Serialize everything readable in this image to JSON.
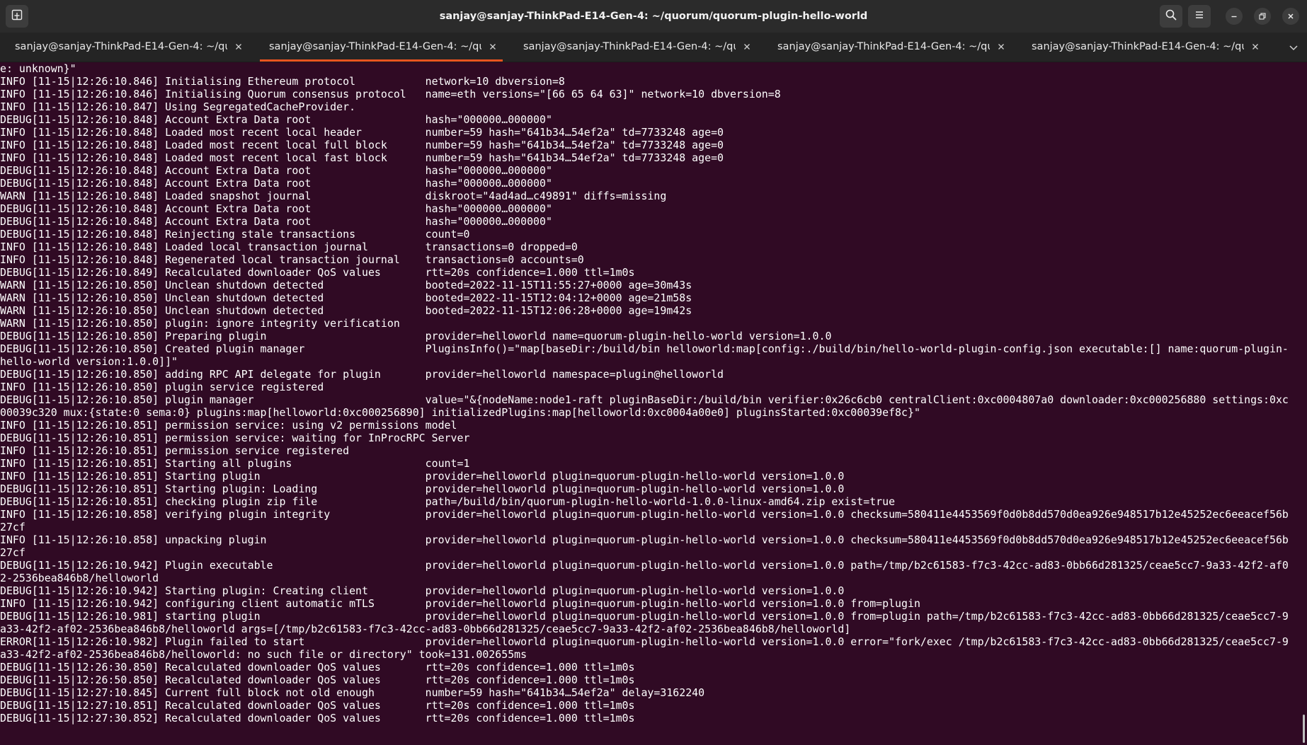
{
  "window": {
    "title": "sanjay@sanjay-ThinkPad-E14-Gen-4: ~/quorum/quorum-plugin-hello-world"
  },
  "header_buttons": {
    "new_tab_icon": "new-tab-icon",
    "search_icon": "search-icon",
    "menu_icon": "hamburger-menu-icon",
    "minimize_icon": "minimize-icon",
    "maximize_icon": "maximize-icon",
    "close_icon": "close-icon"
  },
  "tabs": [
    {
      "label": "sanjay@sanjay-ThinkPad-E14-Gen-4: ~/quo…",
      "active": false
    },
    {
      "label": "sanjay@sanjay-ThinkPad-E14-Gen-4: ~/quo…",
      "active": true
    },
    {
      "label": "sanjay@sanjay-ThinkPad-E14-Gen-4: ~/quo…",
      "active": false
    },
    {
      "label": "sanjay@sanjay-ThinkPad-E14-Gen-4: ~/quo…",
      "active": false
    },
    {
      "label": "sanjay@sanjay-ThinkPad-E14-Gen-4: ~/quo…",
      "active": false
    }
  ],
  "colors": {
    "terminal_bg": "#300a24",
    "header_bg": "#2b2b2b",
    "tab_bg": "#242424",
    "accent": "#e95420",
    "text": "#ffffff"
  },
  "terminal": {
    "lines": [
      "e: unknown}\"",
      "INFO [11-15|12:26:10.846] Initialising Ethereum protocol           network=10 dbversion=8",
      "INFO [11-15|12:26:10.846] Initialising Quorum consensus protocol   name=eth versions=\"[66 65 64 63]\" network=10 dbversion=8",
      "INFO [11-15|12:26:10.847] Using SegregatedCacheProvider.",
      "DEBUG[11-15|12:26:10.848] Account Extra Data root                  hash=\"000000…000000\"",
      "INFO [11-15|12:26:10.848] Loaded most recent local header          number=59 hash=\"641b34…54ef2a\" td=7733248 age=0",
      "INFO [11-15|12:26:10.848] Loaded most recent local full block      number=59 hash=\"641b34…54ef2a\" td=7733248 age=0",
      "INFO [11-15|12:26:10.848] Loaded most recent local fast block      number=59 hash=\"641b34…54ef2a\" td=7733248 age=0",
      "DEBUG[11-15|12:26:10.848] Account Extra Data root                  hash=\"000000…000000\"",
      "DEBUG[11-15|12:26:10.848] Account Extra Data root                  hash=\"000000…000000\"",
      "WARN [11-15|12:26:10.848] Loaded snapshot journal                  diskroot=\"4ad4ad…c49891\" diffs=missing",
      "DEBUG[11-15|12:26:10.848] Account Extra Data root                  hash=\"000000…000000\"",
      "DEBUG[11-15|12:26:10.848] Account Extra Data root                  hash=\"000000…000000\"",
      "DEBUG[11-15|12:26:10.848] Reinjecting stale transactions           count=0",
      "INFO [11-15|12:26:10.848] Loaded local transaction journal         transactions=0 dropped=0",
      "INFO [11-15|12:26:10.848] Regenerated local transaction journal    transactions=0 accounts=0",
      "DEBUG[11-15|12:26:10.849] Recalculated downloader QoS values       rtt=20s confidence=1.000 ttl=1m0s",
      "WARN [11-15|12:26:10.850] Unclean shutdown detected                booted=2022-11-15T11:55:27+0000 age=30m43s",
      "WARN [11-15|12:26:10.850] Unclean shutdown detected                booted=2022-11-15T12:04:12+0000 age=21m58s",
      "WARN [11-15|12:26:10.850] Unclean shutdown detected                booted=2022-11-15T12:06:28+0000 age=19m42s",
      "WARN [11-15|12:26:10.850] plugin: ignore integrity verification",
      "DEBUG[11-15|12:26:10.850] Preparing plugin                         provider=helloworld name=quorum-plugin-hello-world version=1.0.0",
      "DEBUG[11-15|12:26:10.850] Created plugin manager                   PluginsInfo()=\"map[baseDir:/build/bin helloworld:map[config:./build/bin/hello-world-plugin-config.json executable:[] name:quorum-plugin-",
      "hello-world version:1.0.0]]\"",
      "DEBUG[11-15|12:26:10.850] adding RPC API delegate for plugin       provider=helloworld namespace=plugin@helloworld",
      "INFO [11-15|12:26:10.850] plugin service registered",
      "DEBUG[11-15|12:26:10.850] plugin manager                           value=\"&{nodeName:node1-raft pluginBaseDir:/build/bin verifier:0x26c6cb0 centralClient:0xc0004807a0 downloader:0xc000256880 settings:0xc",
      "00039c320 mux:{state:0 sema:0} plugins:map[helloworld:0xc000256890] initializedPlugins:map[helloworld:0xc0004a00e0] pluginsStarted:0xc00039ef8c}\"",
      "INFO [11-15|12:26:10.851] permission service: using v2 permissions model",
      "DEBUG[11-15|12:26:10.851] permission service: waiting for InProcRPC Server",
      "INFO [11-15|12:26:10.851] permission service registered",
      "INFO [11-15|12:26:10.851] Starting all plugins                     count=1",
      "INFO [11-15|12:26:10.851] Starting plugin                          provider=helloworld plugin=quorum-plugin-hello-world version=1.0.0",
      "DEBUG[11-15|12:26:10.851] Starting plugin: Loading                 provider=helloworld plugin=quorum-plugin-hello-world version=1.0.0",
      "DEBUG[11-15|12:26:10.851] checking plugin zip file                 path=/build/bin/quorum-plugin-hello-world-1.0.0-linux-amd64.zip exist=true",
      "INFO [11-15|12:26:10.858] verifying plugin integrity               provider=helloworld plugin=quorum-plugin-hello-world version=1.0.0 checksum=580411e4453569f0d0b8dd570d0ea926e948517b12e45252ec6eeacef56b",
      "27cf",
      "INFO [11-15|12:26:10.858] unpacking plugin                         provider=helloworld plugin=quorum-plugin-hello-world version=1.0.0 checksum=580411e4453569f0d0b8dd570d0ea926e948517b12e45252ec6eeacef56b",
      "27cf",
      "DEBUG[11-15|12:26:10.942] Plugin executable                        provider=helloworld plugin=quorum-plugin-hello-world version=1.0.0 path=/tmp/b2c61583-f7c3-42cc-ad83-0bb66d281325/ceae5cc7-9a33-42f2-af0",
      "2-2536bea846b8/helloworld",
      "DEBUG[11-15|12:26:10.942] Starting plugin: Creating client         provider=helloworld plugin=quorum-plugin-hello-world version=1.0.0",
      "INFO [11-15|12:26:10.942] configuring client automatic mTLS        provider=helloworld plugin=quorum-plugin-hello-world version=1.0.0 from=plugin",
      "DEBUG[11-15|12:26:10.981] starting plugin                          provider=helloworld plugin=quorum-plugin-hello-world version=1.0.0 from=plugin path=/tmp/b2c61583-f7c3-42cc-ad83-0bb66d281325/ceae5cc7-9",
      "a33-42f2-af02-2536bea846b8/helloworld args=[/tmp/b2c61583-f7c3-42cc-ad83-0bb66d281325/ceae5cc7-9a33-42f2-af02-2536bea846b8/helloworld]",
      "ERROR[11-15|12:26:10.982] Plugin failed to start                   provider=helloworld plugin=quorum-plugin-hello-world version=1.0.0 error=\"fork/exec /tmp/b2c61583-f7c3-42cc-ad83-0bb66d281325/ceae5cc7-9",
      "a33-42f2-af02-2536bea846b8/helloworld: no such file or directory\" took=131.002655ms",
      "DEBUG[11-15|12:26:30.850] Recalculated downloader QoS values       rtt=20s confidence=1.000 ttl=1m0s",
      "DEBUG[11-15|12:26:50.850] Recalculated downloader QoS values       rtt=20s confidence=1.000 ttl=1m0s",
      "DEBUG[11-15|12:27:10.845] Current full block not old enough        number=59 hash=\"641b34…54ef2a\" delay=3162240",
      "DEBUG[11-15|12:27:10.851] Recalculated downloader QoS values       rtt=20s confidence=1.000 ttl=1m0s",
      "DEBUG[11-15|12:27:30.852] Recalculated downloader QoS values       rtt=20s confidence=1.000 ttl=1m0s"
    ]
  }
}
